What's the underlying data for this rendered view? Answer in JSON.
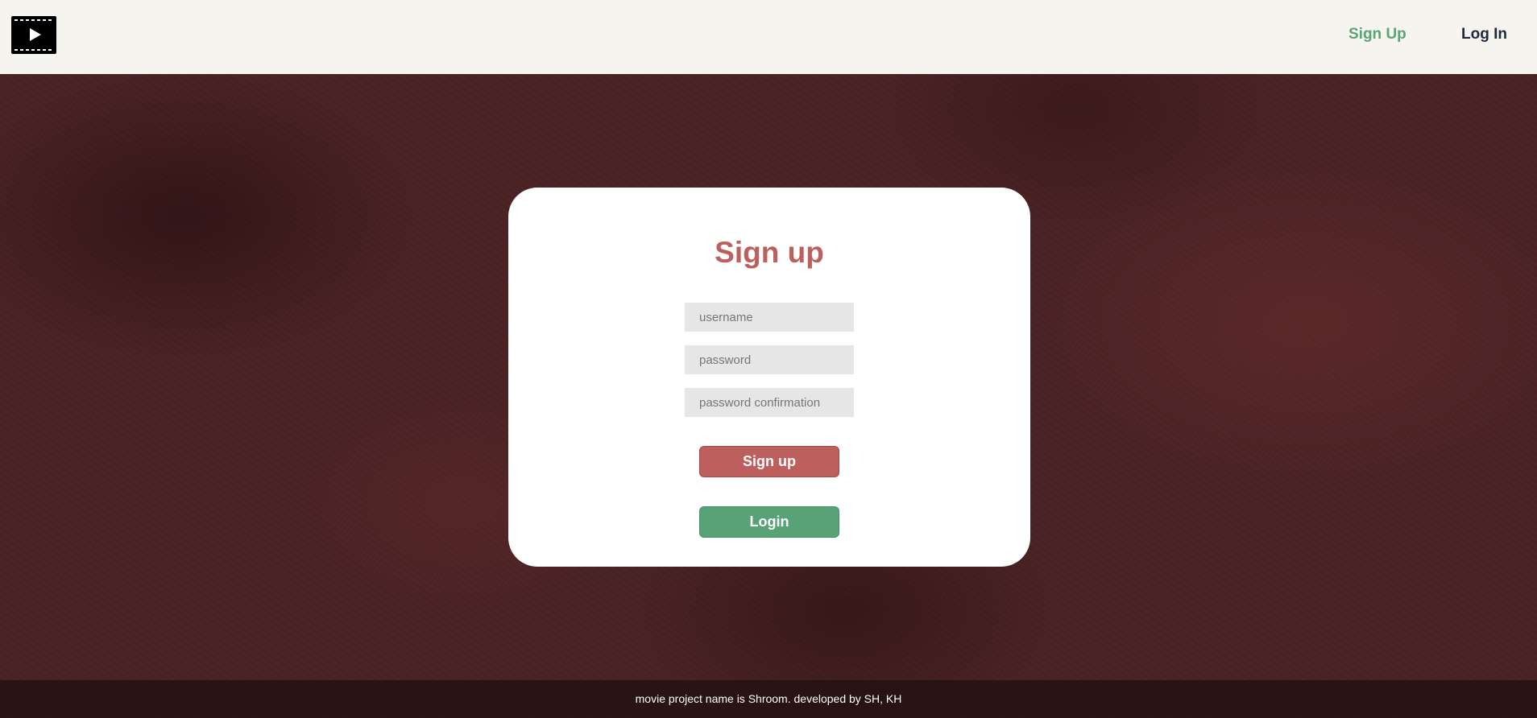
{
  "navbar": {
    "logo_icon": "film-play-icon",
    "signup_label": "Sign Up",
    "login_label": "Log In",
    "signup_color": "#5aa374",
    "login_color": "#1f2a3c"
  },
  "signup_form": {
    "title": "Sign up",
    "username_placeholder": "username",
    "password_placeholder": "password",
    "password_confirmation_placeholder": "password confirmation",
    "signup_button_label": "Sign up",
    "login_button_label": "Login",
    "accent_color": "#bd5f5c",
    "secondary_color": "#57a277"
  },
  "footer": {
    "text": "movie project name is Shroom. developed by SH, KH"
  }
}
